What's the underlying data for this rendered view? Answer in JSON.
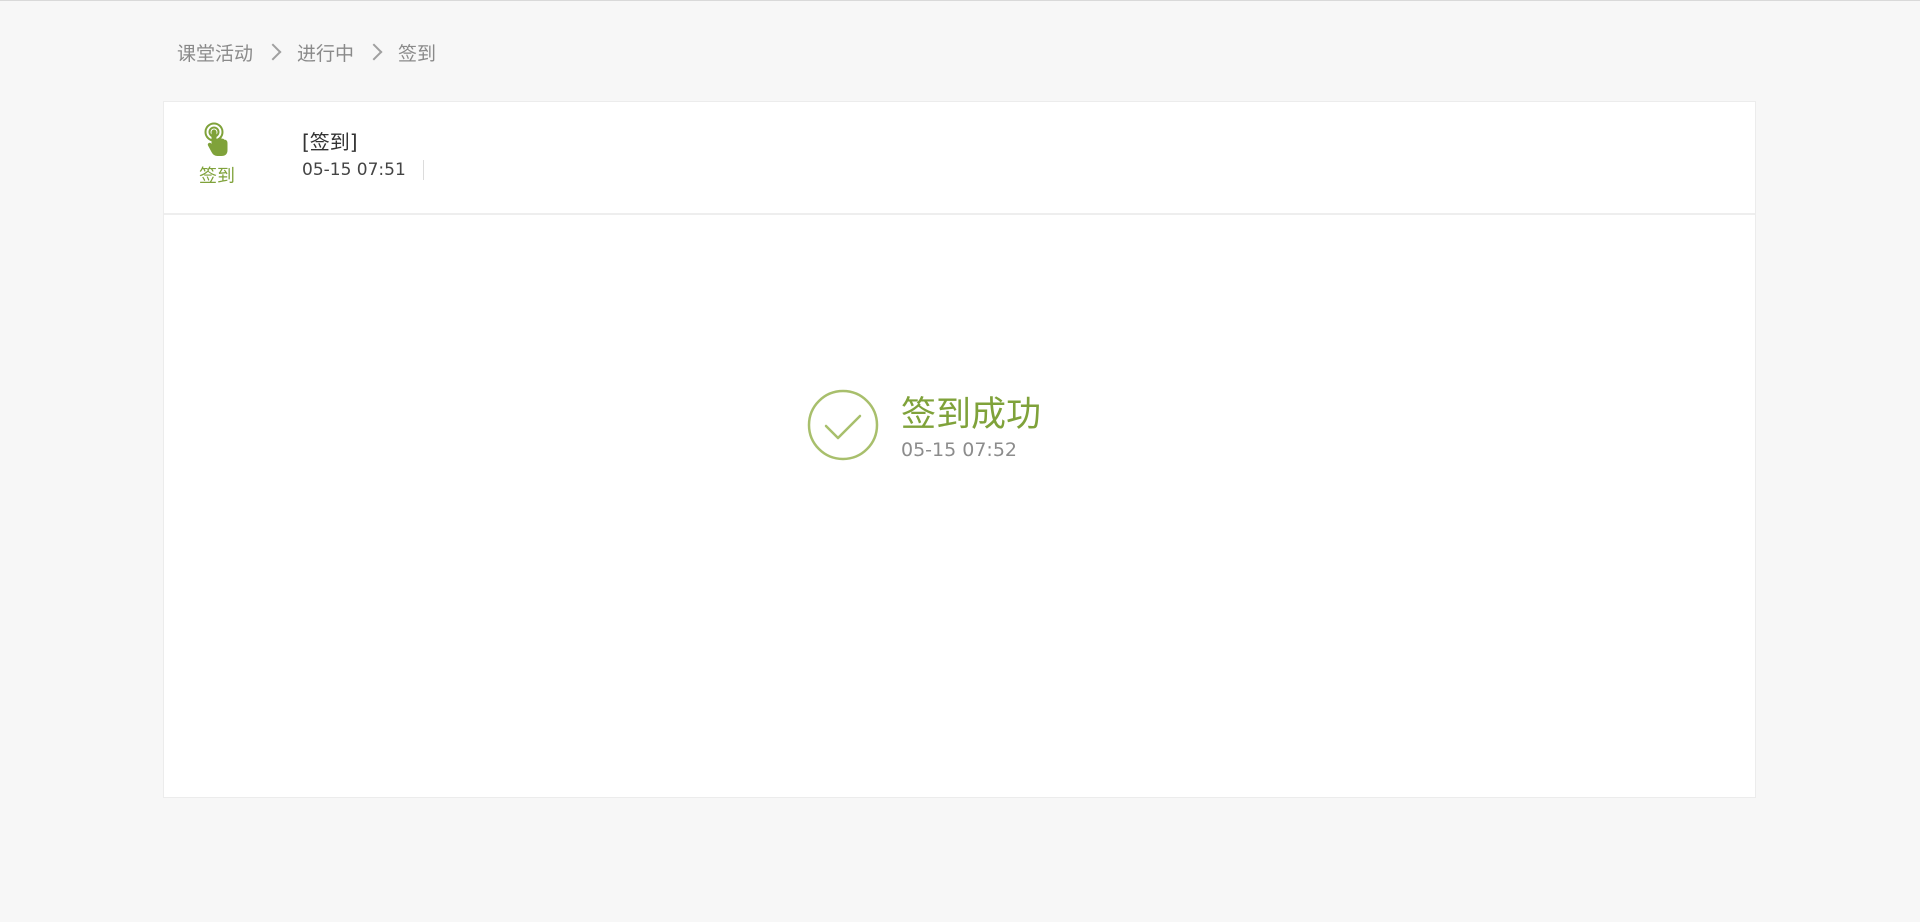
{
  "breadcrumb": {
    "items": [
      "课堂活动",
      "进行中",
      "签到"
    ]
  },
  "activity": {
    "type_icon": "tap-hand-icon",
    "type_label": "签到",
    "title": "[签到]",
    "time": "05-15 07:51"
  },
  "result": {
    "icon": "check-circle-icon",
    "title": "签到成功",
    "time": "05-15 07:52"
  },
  "colors": {
    "accent": "#7fa23a",
    "accent_light": "#a8bf6c",
    "page_background": "#f7f7f7"
  }
}
